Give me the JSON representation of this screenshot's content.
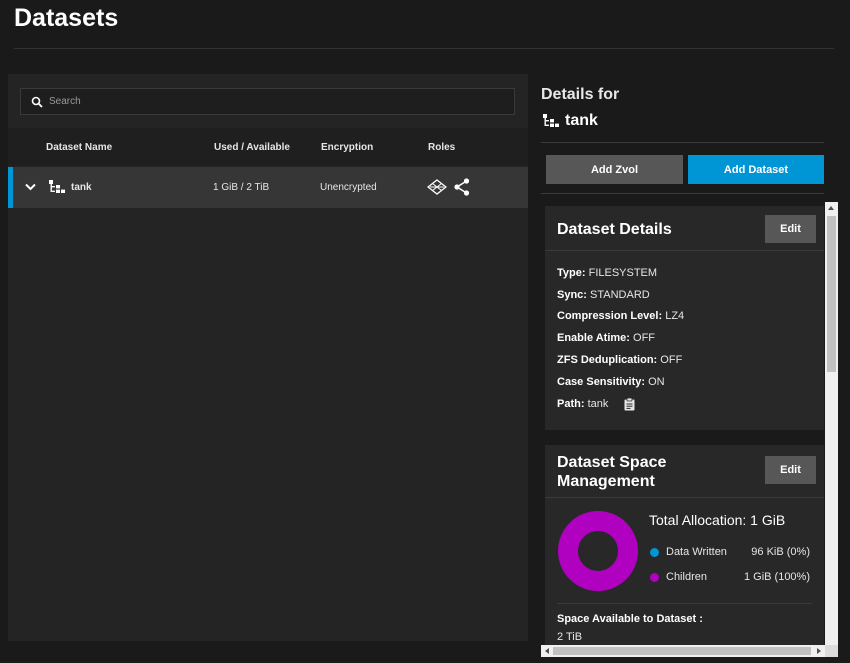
{
  "page": {
    "title": "Datasets"
  },
  "search": {
    "placeholder": "Search"
  },
  "table": {
    "headers": {
      "name": "Dataset Name",
      "used": "Used / Available",
      "encryption": "Encryption",
      "roles": "Roles"
    },
    "rows": [
      {
        "name": "tank",
        "used": "1 GiB / 2 TiB",
        "encryption": "Unencrypted"
      }
    ]
  },
  "details": {
    "heading": "Details for",
    "name": "tank",
    "add_zvol": "Add Zvol",
    "add_dataset": "Add Dataset"
  },
  "dataset_details": {
    "title": "Dataset Details",
    "edit": "Edit",
    "fields": [
      {
        "label": "Type:",
        "value": "FILESYSTEM"
      },
      {
        "label": "Sync:",
        "value": "STANDARD"
      },
      {
        "label": "Compression Level:",
        "value": "LZ4"
      },
      {
        "label": "Enable Atime:",
        "value": "OFF"
      },
      {
        "label": "ZFS Deduplication:",
        "value": "OFF"
      },
      {
        "label": "Case Sensitivity:",
        "value": "ON"
      },
      {
        "label": "Path:",
        "value": "tank"
      }
    ]
  },
  "space_management": {
    "title_line1": "Dataset Space",
    "title_line2": "Management",
    "edit": "Edit",
    "total_allocation": "Total Allocation:  1 GiB",
    "legend": [
      {
        "name": "Data Written",
        "value": "96 KiB (0%)",
        "color": "#0095d5"
      },
      {
        "name": "Children",
        "value": "1 GiB (100%)",
        "color": "#b000c0"
      }
    ],
    "available_label": "Space Available to Dataset :",
    "available_value": "2 TiB"
  },
  "colors": {
    "accent": "#0095d5",
    "donut": "#b000c0"
  }
}
